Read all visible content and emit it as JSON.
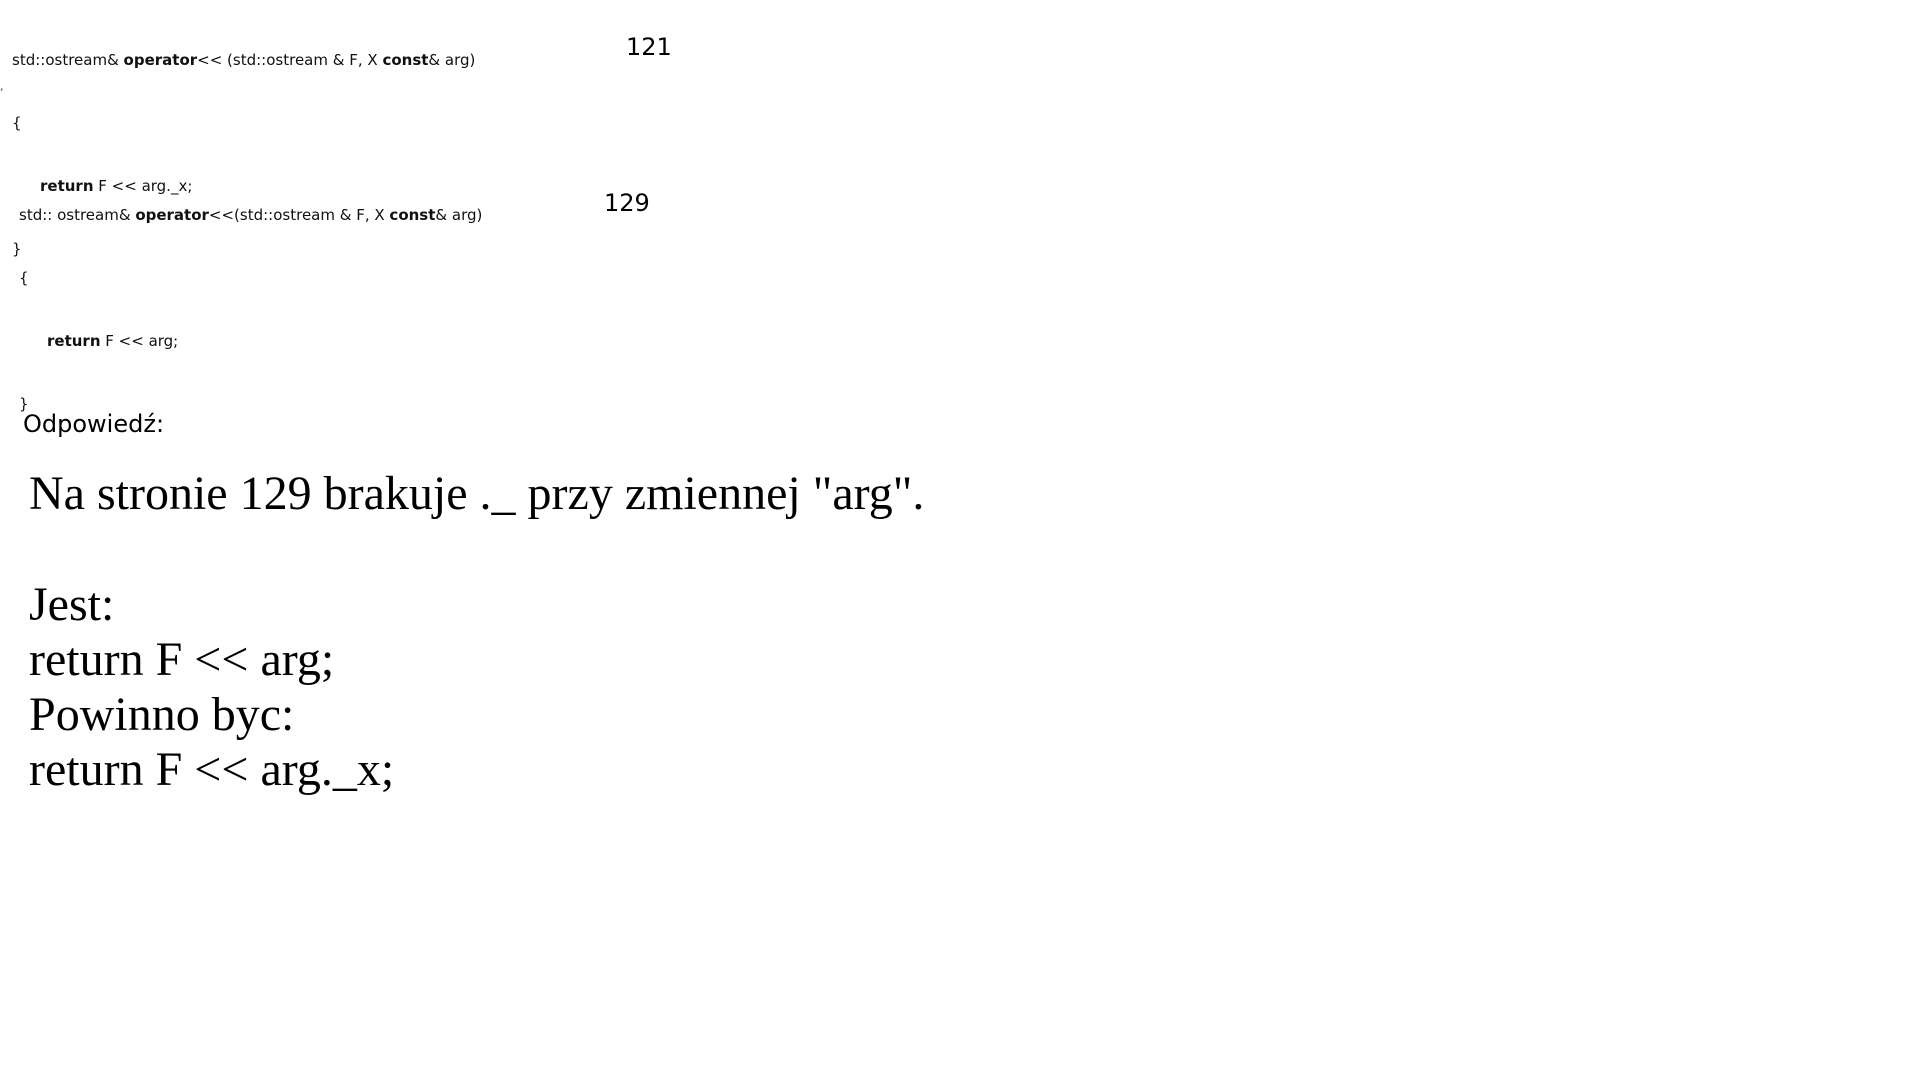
{
  "snippet_121": {
    "line1_pre": "std::ostream& ",
    "line1_kw": "operator",
    "line1_mid": "<< (std::ostream & F, X ",
    "line1_kw2": "const",
    "line1_post": "& arg)",
    "open_brace": "{",
    "return_kw": "return",
    "return_rest": " F << arg._x;",
    "close_brace": "}",
    "page_number": "121"
  },
  "snippet_129": {
    "line1_pre": "std:: ostream& ",
    "line1_kw": "operator",
    "line1_mid": "<<(std::ostream & F, X ",
    "line1_kw2": "const",
    "line1_post": "& arg)",
    "open_brace": "{",
    "return_kw": "return",
    "return_rest": " F << arg;",
    "close_brace": "}",
    "page_number": "129"
  },
  "answer": {
    "label": "Odpowiedź:",
    "summary": "Na stronie 129 brakuje ._ przy zmiennej \"arg\".",
    "is_label": "Jest:",
    "is_code": "return F << arg;",
    "should_label": "Powinno byc:",
    "should_code": "return F << arg._x;"
  }
}
